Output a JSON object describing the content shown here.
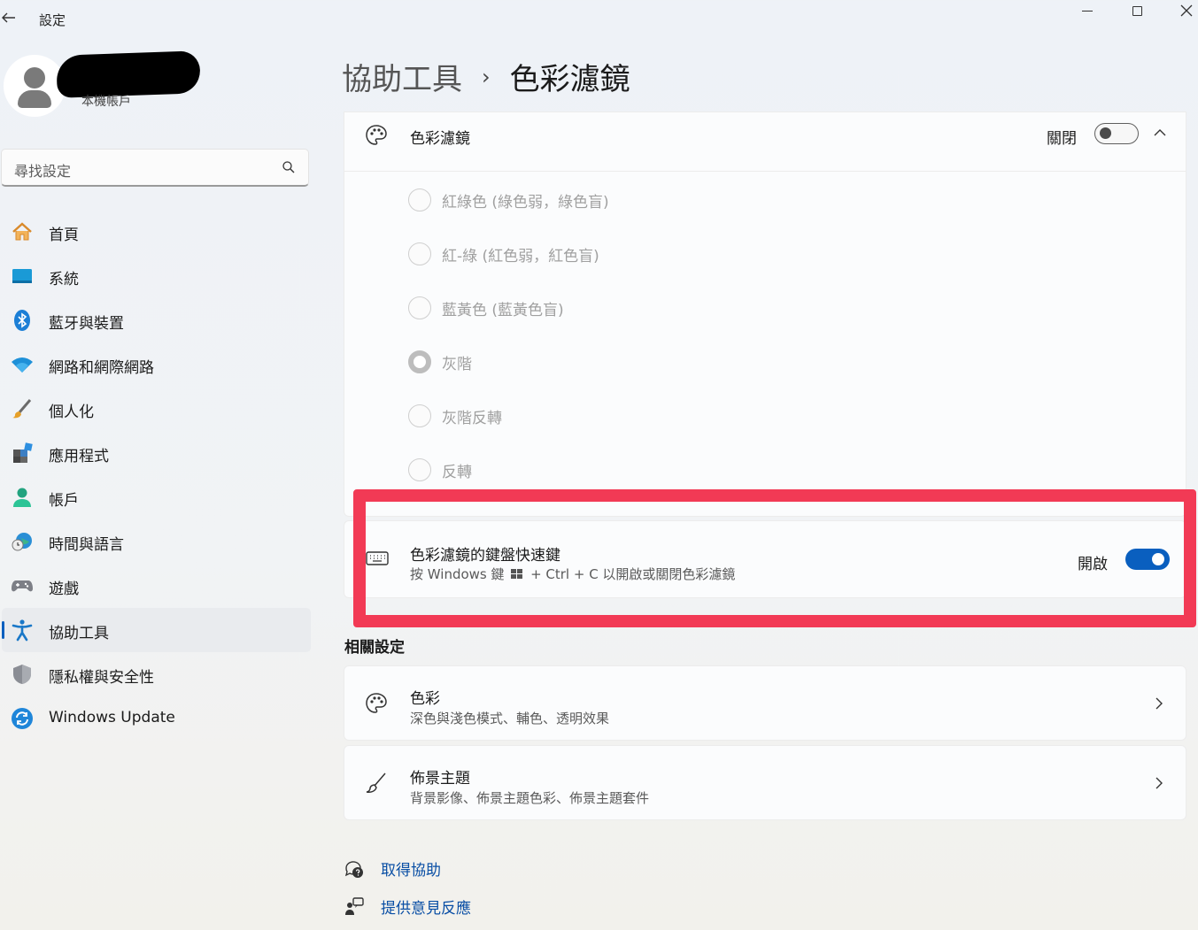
{
  "window": {
    "title": "設定",
    "back_symbol": "←",
    "close_symbol": "✕"
  },
  "profile": {
    "account_type": "本機帳戶"
  },
  "search": {
    "placeholder": "尋找設定"
  },
  "sidebar": {
    "items": [
      {
        "label": "首頁",
        "icon": "home-icon"
      },
      {
        "label": "系統",
        "icon": "system-icon"
      },
      {
        "label": "藍牙與裝置",
        "icon": "bluetooth-icon"
      },
      {
        "label": "網路和網際網路",
        "icon": "wifi-icon"
      },
      {
        "label": "個人化",
        "icon": "brush-icon"
      },
      {
        "label": "應用程式",
        "icon": "apps-icon"
      },
      {
        "label": "帳戶",
        "icon": "account-icon"
      },
      {
        "label": "時間與語言",
        "icon": "clock-globe-icon"
      },
      {
        "label": "遊戲",
        "icon": "gamepad-icon"
      },
      {
        "label": "協助工具",
        "icon": "accessibility-icon",
        "active": true
      },
      {
        "label": "隱私權與安全性",
        "icon": "shield-icon"
      },
      {
        "label": "Windows Update",
        "icon": "update-icon"
      }
    ]
  },
  "breadcrumb": {
    "parent": "協助工具",
    "separator": "›",
    "current": "色彩濾鏡"
  },
  "color_filter": {
    "title": "色彩濾鏡",
    "toggle_label": "關閉",
    "toggle_state": "off",
    "options": [
      {
        "label": "紅綠色 (綠色弱，綠色盲)",
        "selected": false
      },
      {
        "label": "紅-綠 (紅色弱，紅色盲)",
        "selected": false
      },
      {
        "label": "藍黃色 (藍黃色盲)",
        "selected": false
      },
      {
        "label": "灰階",
        "selected": true
      },
      {
        "label": "灰階反轉",
        "selected": false
      },
      {
        "label": "反轉",
        "selected": false
      }
    ]
  },
  "shortcut": {
    "title": "色彩濾鏡的鍵盤快速鍵",
    "description_before": "按 Windows 鍵",
    "description_after": "+ Ctrl + C 以開啟或關閉色彩濾鏡",
    "toggle_label": "開啟",
    "toggle_state": "on"
  },
  "related": {
    "heading": "相關設定",
    "items": [
      {
        "title": "色彩",
        "description": "深色與淺色模式、輔色、透明效果",
        "icon": "palette-icon"
      },
      {
        "title": "佈景主題",
        "description": "背景影像、佈景主題色彩、佈景主題套件",
        "icon": "brush-icon"
      }
    ]
  },
  "help": {
    "get_help": "取得協助",
    "feedback": "提供意見反應"
  },
  "colors": {
    "accent": "#0a5fbf",
    "highlight_border": "#f23a55",
    "link": "#0a4fa5"
  }
}
